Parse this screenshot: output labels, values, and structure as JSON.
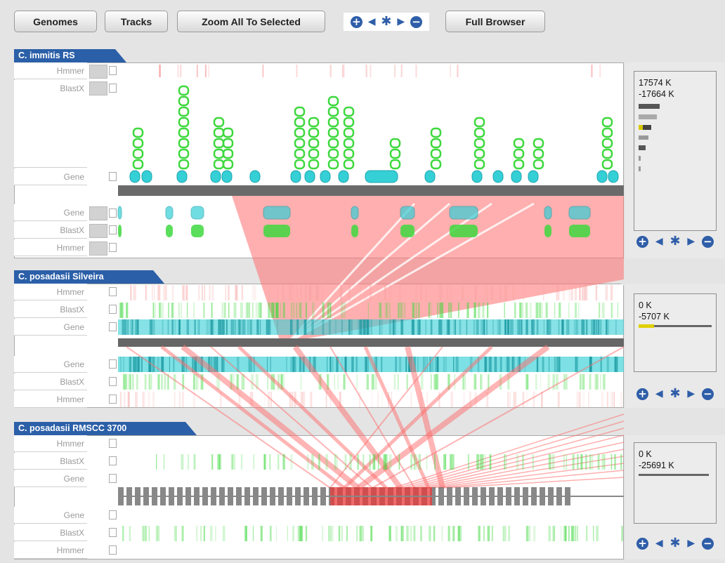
{
  "toolbar": {
    "genomes": "Genomes",
    "tracks": "Tracks",
    "zoom_all": "Zoom All To Selected",
    "full_browser": "Full Browser"
  },
  "nav_icons": [
    "zoom-in-icon",
    "pan-left-icon",
    "reset-icon",
    "pan-right-icon",
    "zoom-out-icon"
  ],
  "panels": [
    {
      "title": "C. immitis RS",
      "top_tracks": [
        "Hmmer",
        "BlastX",
        "Gene"
      ],
      "bottom_tracks": [
        "Gene",
        "BlastX",
        "Hmmer"
      ],
      "range_start": "17574 K",
      "range_end": "-17664 K"
    },
    {
      "title": "C. posadasii Silveira",
      "top_tracks": [
        "Hmmer",
        "BlastX",
        "Gene"
      ],
      "bottom_tracks": [
        "Gene",
        "BlastX",
        "Hmmer"
      ],
      "range_start": "0 K",
      "range_end": "-5707 K"
    },
    {
      "title": "C. posadasii RMSCC 3700",
      "top_tracks": [
        "Hmmer",
        "BlastX",
        "Gene"
      ],
      "bottom_tracks": [
        "Gene",
        "BlastX",
        "Hmmer"
      ],
      "range_start": "0 K",
      "range_end": "-25691 K"
    }
  ],
  "colors": {
    "panel_tab": "#2b5fa8",
    "gene": "#35cfd6",
    "blastx": "#3ed83e",
    "hmmer": "#f7a0a0",
    "synteny": "#ff6e6e"
  }
}
